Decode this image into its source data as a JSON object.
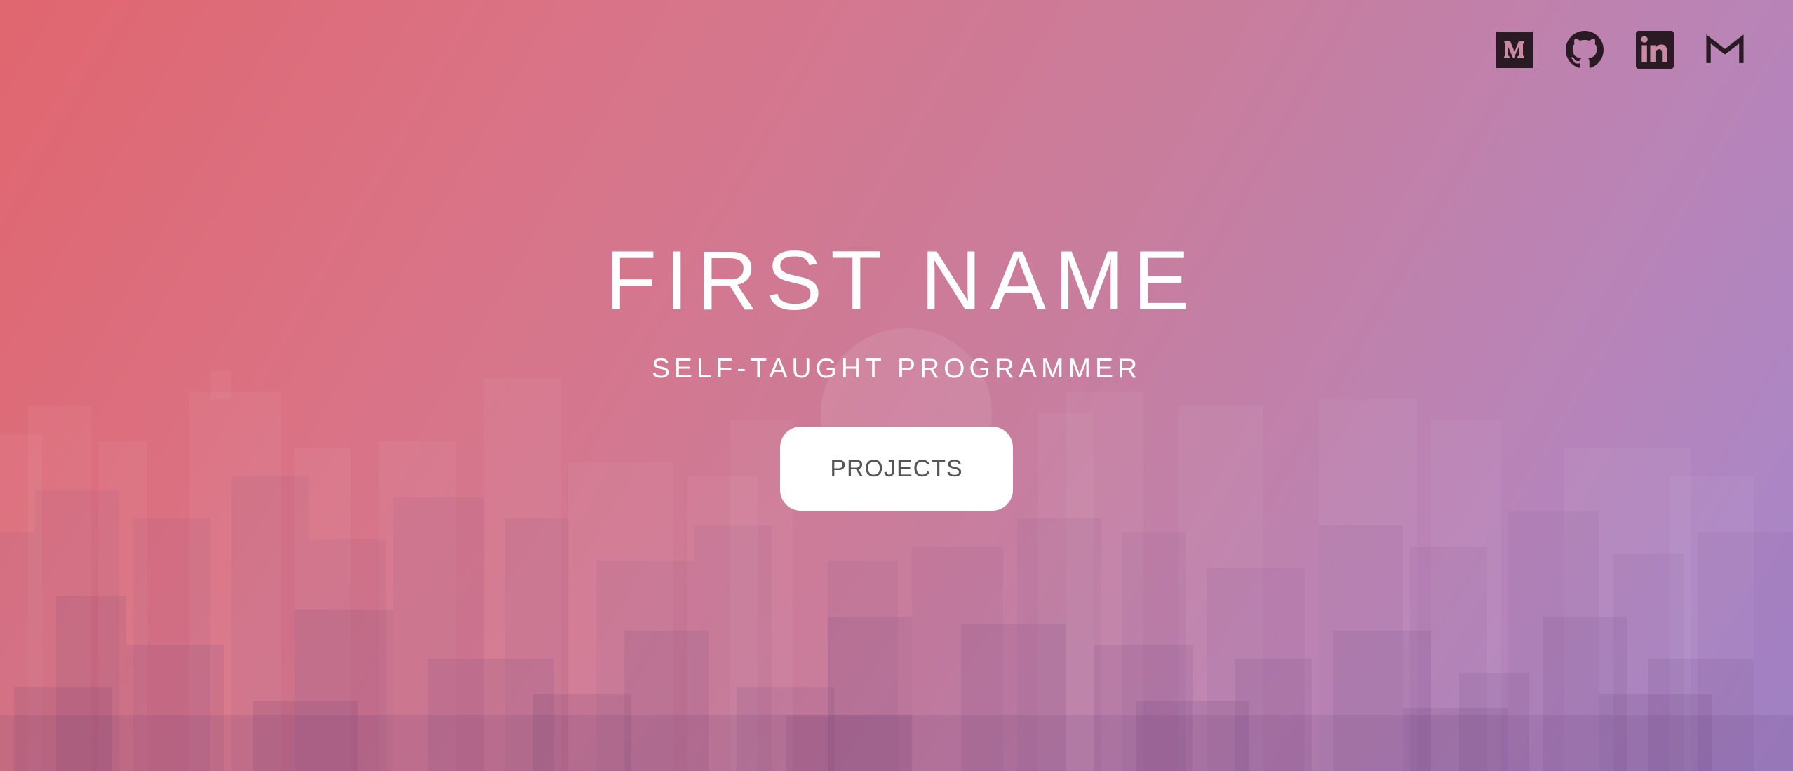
{
  "hero": {
    "name": "FIRST NAME",
    "tagline": "SELF-TAUGHT PROGRAMMER",
    "projects_label": "PROJECTS"
  },
  "social_links": [
    {
      "icon": "medium-icon"
    },
    {
      "icon": "github-icon"
    },
    {
      "icon": "linkedin-icon"
    },
    {
      "icon": "gmail-icon"
    }
  ],
  "colors": {
    "gradient_start": "#e0666f",
    "gradient_mid": "#c97d9c",
    "gradient_end": "#a487cc",
    "title_text": "#ffffff",
    "button_bg": "#ffffff",
    "button_text": "#555555",
    "icon": "#2a1a24"
  }
}
